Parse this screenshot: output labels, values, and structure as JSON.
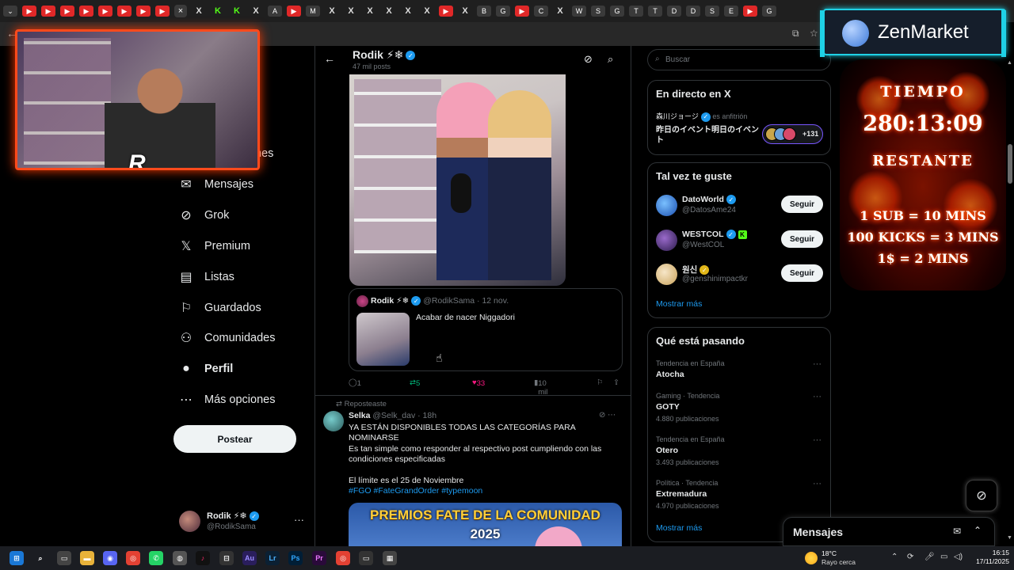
{
  "browser": {
    "tab_icons": [
      "youtube",
      "youtube",
      "youtube",
      "youtube",
      "youtube",
      "youtube",
      "youtube",
      "youtube",
      "close",
      "x",
      "kick",
      "kick",
      "x",
      "a",
      "youtube",
      "ms",
      "x",
      "x",
      "x",
      "x",
      "x",
      "x",
      "youtube",
      "x",
      "brave",
      "globe",
      "youtube",
      "c",
      "x",
      "w",
      "steam",
      "gmail",
      "tiktok",
      "tiktok",
      "docs",
      "docs",
      "sheets",
      "ext",
      "youtube",
      "globe"
    ],
    "active_tab_close": "×"
  },
  "nav": {
    "partial_label": "nes",
    "items": [
      {
        "icon": "mail-icon",
        "glyph": "✉",
        "label": "Mensajes"
      },
      {
        "icon": "grok-icon",
        "glyph": "⊘",
        "label": "Grok"
      },
      {
        "icon": "x-icon",
        "glyph": "𝕏",
        "label": "Premium"
      },
      {
        "icon": "list-icon",
        "glyph": "▤",
        "label": "Listas"
      },
      {
        "icon": "bookmark-icon",
        "glyph": "⚐",
        "label": "Guardados"
      },
      {
        "icon": "communities-icon",
        "glyph": "⚇",
        "label": "Comunidades"
      },
      {
        "icon": "profile-icon",
        "glyph": "●",
        "label": "Perfil"
      },
      {
        "icon": "more-icon",
        "glyph": "⋯",
        "label": "Más opciones"
      }
    ],
    "post_button": "Postear",
    "account": {
      "name": "Rodik ⚡❄",
      "handle": "@RodikSama",
      "more": "···"
    }
  },
  "profile_header": {
    "name": "Rodik ⚡❄",
    "posts_count": "47 mil posts"
  },
  "tweet1": {
    "quote": {
      "name": "Rodik ⚡❄",
      "handle_date": "@RodikSama · 12 nov.",
      "text": "Acabar de nacer Niggadori"
    },
    "actions": {
      "replies": "1",
      "reposts": "5",
      "likes": "33",
      "views": "10 mil"
    }
  },
  "tweet2": {
    "repost_label": "Reposteaste",
    "name": "Selka",
    "handle_time": "@Selk_dav · 18h",
    "line1": "YA ESTÁN DISPONIBLES TODAS LAS CATEGORÍAS PARA NOMINARSE",
    "line2": "Es tan simple como responder al respectivo post cumpliendo con las condiciones especificadas",
    "line3": "El límite es el 25 de Noviembre",
    "hashtags": "#FGO #FateGrandOrder #typemoon",
    "banner_line1": "PREMIOS FATE DE LA COMUNIDAD",
    "banner_line2": "2025"
  },
  "sidebar": {
    "search_placeholder": "Buscar",
    "live": {
      "title": "En directo en X",
      "host_name": "森川ジョージ",
      "host_label": "es anfitrión",
      "event_title": "昨日のイベント明日のイベント",
      "listeners": "+131"
    },
    "who_to_follow": {
      "title": "Tal vez te guste",
      "users": [
        {
          "name": "DatoWorld",
          "handle": "@DatosAme24",
          "button": "Seguir",
          "badge": "verified"
        },
        {
          "name": "WESTCOL",
          "handle": "@WestCOL",
          "button": "Seguir",
          "badge": "verified",
          "extra": "K"
        },
        {
          "name": "원신",
          "handle": "@genshinimpactkr",
          "button": "Seguir",
          "badge": "gold"
        }
      ],
      "more": "Mostrar más"
    },
    "trends": {
      "title": "Qué está pasando",
      "items": [
        {
          "category": "Tendencia en España",
          "topic": "Atocha",
          "count": ""
        },
        {
          "category": "Gaming · Tendencia",
          "topic": "GOTY",
          "count": "4.880 publicaciones"
        },
        {
          "category": "Tendencia en España",
          "topic": "Otero",
          "count": "3.493 publicaciones"
        },
        {
          "category": "Política · Tendencia",
          "topic": "Extremadura",
          "count": "4.970 publicaciones"
        }
      ],
      "more": "Mostrar más"
    }
  },
  "messages_dock": {
    "title": "Mensajes"
  },
  "overlay": {
    "sponsor": "ZenMarket",
    "timer_label_top": "TIEMPO",
    "timer_value": "280:13:09",
    "timer_label_bottom": "RESTANTE",
    "rule1": "1 SUB = 10 MINS",
    "rule2": "100 KICKS = 3 MINS",
    "rule3": "1$ = 2 MINS"
  },
  "taskbar": {
    "weather_temp": "18°C",
    "weather_desc": "Rayo cerca",
    "time": "16:15",
    "date": "17/11/2025"
  }
}
